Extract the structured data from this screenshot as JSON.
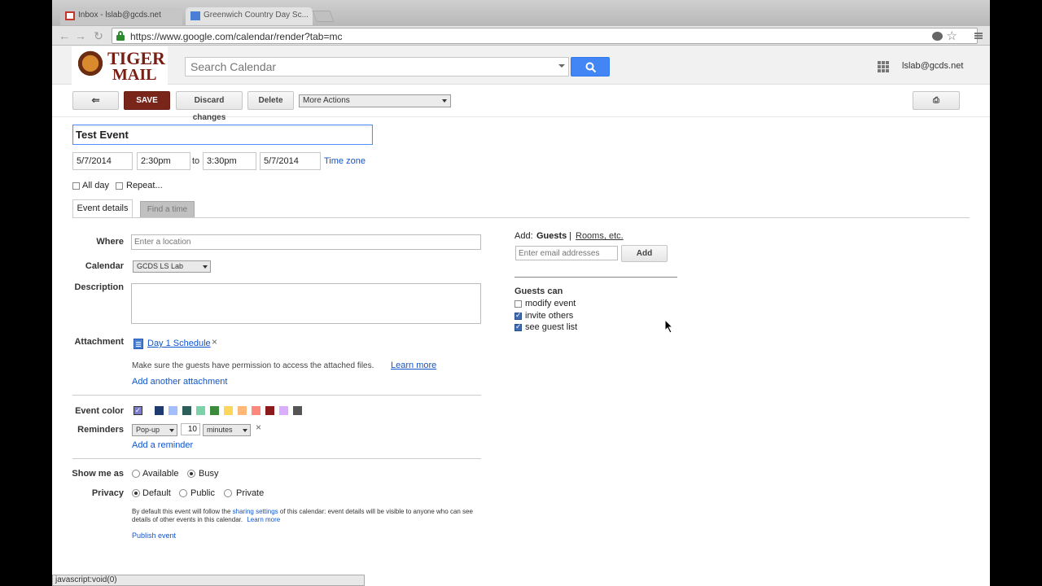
{
  "browser": {
    "tabs": [
      {
        "label": "Inbox - lslab@gcds.net"
      },
      {
        "label": "Greenwich Country Day Sc..."
      }
    ],
    "url": "https://www.google.com/calendar/render?tab=mc",
    "status_text": "javascript:void(0)"
  },
  "header": {
    "logo_line1": "TIGER",
    "logo_line2": "MAIL",
    "search_placeholder": "Search Calendar",
    "account": "lslab@gcds.net"
  },
  "actions": {
    "back": "⇐",
    "save": "SAVE",
    "discard": "Discard changes",
    "delete": "Delete",
    "more": "More Actions",
    "print": "⎙"
  },
  "event": {
    "title": "Test Event",
    "start_date": "5/7/2014",
    "start_time": "2:30pm",
    "to": "to",
    "end_time": "3:30pm",
    "end_date": "5/7/2014",
    "time_zone": "Time zone",
    "all_day": "All day",
    "repeat": "Repeat..."
  },
  "tabs": {
    "details": "Event details",
    "find_time": "Find a time"
  },
  "form": {
    "where_label": "Where",
    "where_placeholder": "Enter a location",
    "calendar_label": "Calendar",
    "calendar_value": "GCDS LS Lab",
    "description_label": "Description",
    "attachment_label": "Attachment",
    "attachment_name": "Day 1 Schedule",
    "attachment_note": "Make sure the guests have permission to access the attached files.",
    "learn_more": "Learn more",
    "add_attachment": "Add another attachment",
    "color_label": "Event color",
    "colors": [
      "#7c7ccf",
      "#1f3a6e",
      "#a4bdfc",
      "#2c5f5a",
      "#7bd1a8",
      "#3c8a3c",
      "#fbd75b",
      "#ffb878",
      "#ff887c",
      "#8b1a1a",
      "#dbadff",
      "#555555"
    ],
    "reminders_label": "Reminders",
    "reminder_method": "Pop-up",
    "reminder_value": "10",
    "reminder_unit": "minutes",
    "add_reminder": "Add a reminder",
    "show_as_label": "Show me as",
    "available": "Available",
    "busy": "Busy",
    "privacy_label": "Privacy",
    "default": "Default",
    "public": "Public",
    "private": "Private",
    "privacy_note_1": "By default this event will follow the",
    "sharing_settings": "sharing settings",
    "privacy_note_2": "of this calendar: event details will be visible to anyone who",
    "privacy_note_3": "can see details of other events in this calendar.",
    "learn_more_2": "Learn more",
    "publish": "Publish event"
  },
  "guests": {
    "add": "Add:",
    "guests": "Guests",
    "sep": "|",
    "rooms": "Rooms, etc.",
    "email_placeholder": "Enter email addresses",
    "add_button": "Add",
    "can_label": "Guests can",
    "modify": "modify event",
    "invite": "invite others",
    "see_list": "see guest list"
  }
}
